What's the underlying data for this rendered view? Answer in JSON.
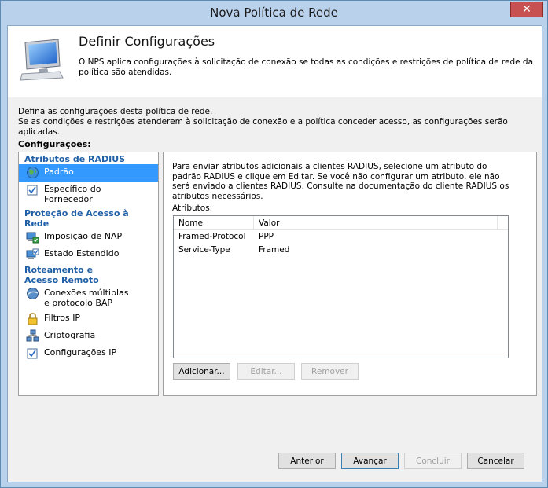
{
  "window": {
    "title": "Nova Política de Rede",
    "close_glyph": "✕"
  },
  "header": {
    "title": "Definir Configurações",
    "description": "O NPS aplica configurações à solicitação de conexão se todas as condições e restrições de política de rede da política são atendidas."
  },
  "intro": {
    "line1": "Defina as configurações desta política de rede.",
    "line2": "Se as condições e restrições atenderem à solicitação de conexão e a política conceder acesso, as configurações serão aplicadas."
  },
  "settings_label": "Configurações:",
  "sidebar": {
    "sections": [
      {
        "title": "Atributos de RADIUS",
        "items": [
          {
            "label": "Padrão",
            "icon": "globe-icon",
            "selected": true
          },
          {
            "label": "Específico do Fornecedor",
            "icon": "checkbox-icon"
          }
        ]
      },
      {
        "title": "Proteção de Acesso à Rede",
        "items": [
          {
            "label": "Imposição de NAP",
            "icon": "nap-icon"
          },
          {
            "label": "Estado Estendido",
            "icon": "monitor-check-icon"
          }
        ]
      },
      {
        "title": "Roteamento e Acesso Remoto",
        "items": [
          {
            "label": "Conexões múltiplas e protocolo BAP",
            "icon": "link-globe-icon"
          },
          {
            "label": "Filtros IP",
            "icon": "lock-icon"
          },
          {
            "label": "Criptografia",
            "icon": "network-icon"
          },
          {
            "label": "Configurações IP",
            "icon": "checkbox-icon"
          }
        ]
      }
    ]
  },
  "panel": {
    "description": "Para enviar atributos adicionais a clientes RADIUS, selecione um atributo do padrão RADIUS e clique em Editar. Se você não configurar um atributo, ele não será enviado a clientes RADIUS. Consulte na documentação do cliente RADIUS os atributos necessários.",
    "attributes_label": "Atributos:",
    "columns": [
      "Nome",
      "Valor"
    ],
    "rows": [
      {
        "name": "Framed-Protocol",
        "value": "PPP"
      },
      {
        "name": "Service-Type",
        "value": "Framed"
      }
    ],
    "buttons": {
      "add": "Adicionar...",
      "edit": "Editar...",
      "remove": "Remover"
    }
  },
  "footer": {
    "back": "Anterior",
    "next": "Avançar",
    "finish": "Concluir",
    "cancel": "Cancelar"
  },
  "colors": {
    "selection": "#3399ff",
    "section_title": "#1f5fa6",
    "close_button": "#c75050"
  }
}
